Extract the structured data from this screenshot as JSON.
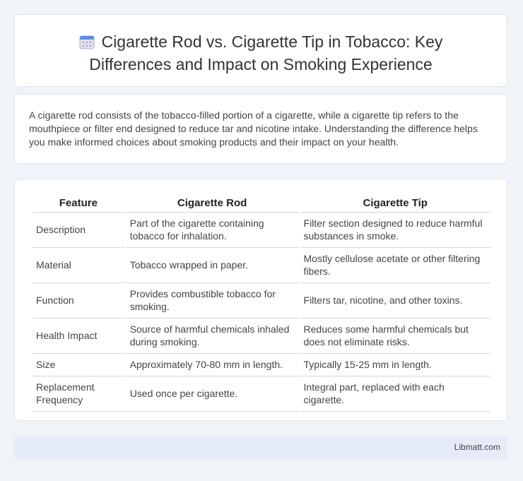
{
  "header": {
    "icon": "calendar-icon",
    "title": "Cigarette Rod vs. Cigarette Tip in Tobacco: Key Differences and Impact on Smoking Experience"
  },
  "intro": "A cigarette rod consists of the tobacco-filled portion of a cigarette, while a cigarette tip refers to the mouthpiece or filter end designed to reduce tar and nicotine intake. Understanding the difference helps you make informed choices about smoking products and their impact on your health.",
  "table": {
    "headers": [
      "Feature",
      "Cigarette Rod",
      "Cigarette Tip"
    ],
    "rows": [
      [
        "Description",
        "Part of the cigarette containing tobacco for inhalation.",
        "Filter section designed to reduce harmful substances in smoke."
      ],
      [
        "Material",
        "Tobacco wrapped in paper.",
        "Mostly cellulose acetate or other filtering fibers."
      ],
      [
        "Function",
        "Provides combustible tobacco for smoking.",
        "Filters tar, nicotine, and other toxins."
      ],
      [
        "Health Impact",
        "Source of harmful chemicals inhaled during smoking.",
        "Reduces some harmful chemicals but does not eliminate risks."
      ],
      [
        "Size",
        "Approximately 70-80 mm in length.",
        "Typically 15-25 mm in length."
      ],
      [
        "Replacement Frequency",
        "Used once per cigarette.",
        "Integral part, replaced with each cigarette."
      ]
    ]
  },
  "footer": {
    "brand": "Libmatt.com"
  }
}
